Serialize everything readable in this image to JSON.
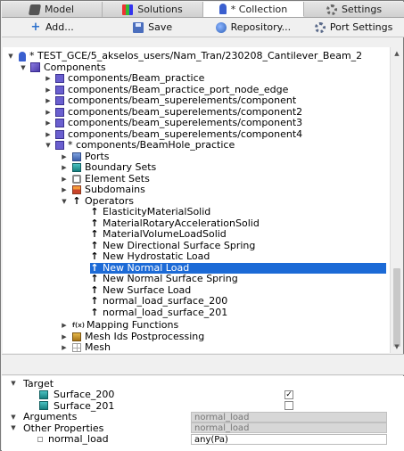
{
  "tabs": [
    {
      "label": "Model",
      "icon": "model-icon"
    },
    {
      "label": "Solutions",
      "icon": "solutions-icon"
    },
    {
      "label": "* Collection",
      "icon": "collection-icon"
    },
    {
      "label": "Settings",
      "icon": "gear-icon"
    }
  ],
  "toolbar": {
    "add_label": "Add...",
    "save_label": "Save",
    "repository_label": "Repository...",
    "port_setting_label": "Port Settings"
  },
  "tree": {
    "root_label": "* TEST_GCE/5_akselos_users/Nam_Tran/230208_Cantilever_Beam_2",
    "components_label": "Components",
    "components": [
      "components/Beam_practice",
      "components/Beam_practice_port_node_edge",
      "components/beam_superelements/component",
      "components/beam_superelements/component2",
      "components/beam_superelements/component3",
      "components/beam_superelements/component4"
    ],
    "beamhole_label": "* components/BeamHole_practice",
    "beamhole_children": {
      "ports": "Ports",
      "boundary_sets": "Boundary Sets",
      "element_sets": "Element Sets",
      "subdomains": "Subdomains",
      "operators": "Operators"
    },
    "operators": [
      "ElasticityMaterialSolid",
      "MaterialRotaryAccelerationSolid",
      "MaterialVolumeLoadSolid",
      "New Directional Surface Spring",
      "New Hydrostatic Load",
      "New Normal Load",
      "New Normal Surface Spring",
      "New Surface Load",
      "normal_load_surface_200",
      "normal_load_surface_201"
    ],
    "selected_operator": "New Normal Load",
    "trailing": {
      "mapping_functions": "Mapping Functions",
      "mesh_ids": "Mesh Ids Postprocessing",
      "mesh": "Mesh"
    }
  },
  "properties": {
    "target_label": "Target",
    "targets": [
      {
        "label": "Surface_200",
        "checked": true,
        "mark": "✓"
      },
      {
        "label": "Surface_201",
        "checked": false,
        "mark": ""
      }
    ],
    "arguments_label": "Arguments",
    "arguments_value": "normal_load",
    "other_properties_label": "Other Properties",
    "other_properties_value": "normal_load",
    "normal_load_label": "normal_load",
    "normal_load_value": "any(Pa)"
  },
  "colors": {
    "selection": "#1c6ad6",
    "component_icon": "#6a5fcf"
  }
}
